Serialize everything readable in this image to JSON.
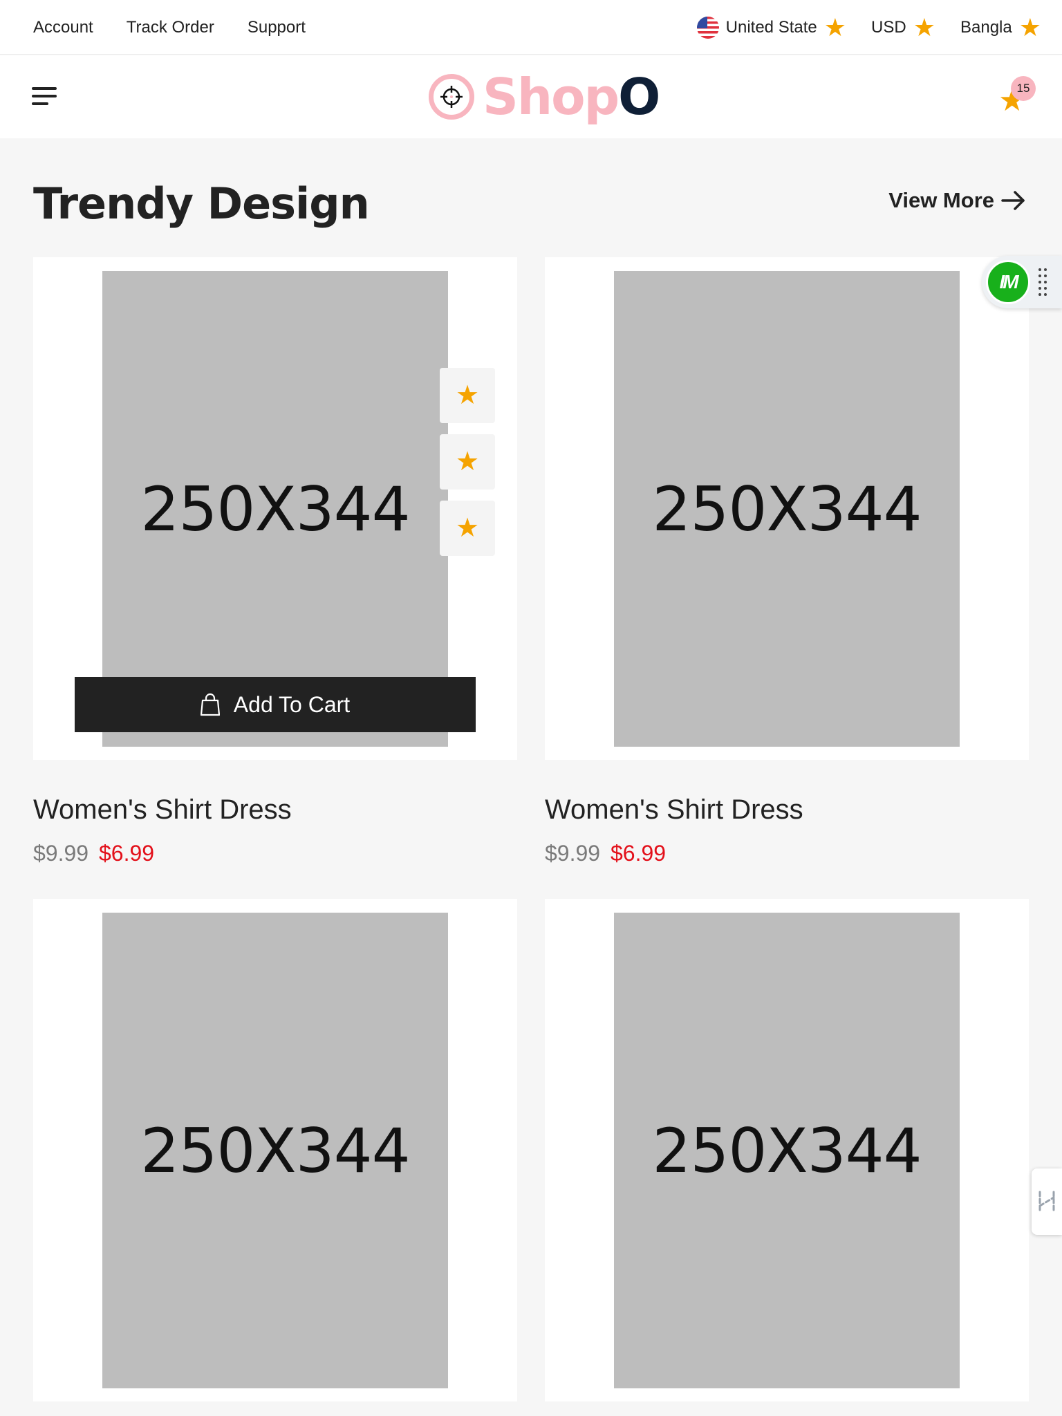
{
  "topbar": {
    "links": [
      "Account",
      "Track Order",
      "Support"
    ],
    "country": "United State",
    "currency": "USD",
    "language": "Bangla"
  },
  "header": {
    "logo_text": "Shop",
    "logo_suffix": "O",
    "cart_count": "15"
  },
  "section": {
    "title": "Trendy Design",
    "view_more": "View More"
  },
  "products": [
    {
      "image_text": "250X344",
      "name": "Women's Shirt Dress",
      "old_price": "$9.99",
      "new_price": "$6.99",
      "add_to_cart": "Add To Cart"
    },
    {
      "image_text": "250X344",
      "name": "Women's Shirt Dress",
      "old_price": "$9.99",
      "new_price": "$6.99"
    },
    {
      "image_text": "250X344"
    },
    {
      "image_text": "250X344"
    }
  ],
  "widgets": {
    "im_label": "IM"
  },
  "colors": {
    "accent_pink": "#f8b5bf",
    "star": "#f5a300",
    "sale_red": "#e3101a",
    "dark": "#222222",
    "im_green": "#18b01b"
  }
}
